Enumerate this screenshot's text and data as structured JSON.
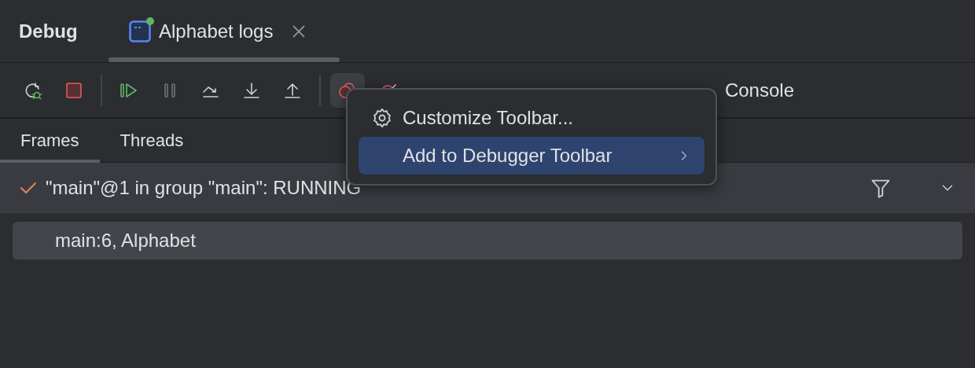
{
  "panel": {
    "title": "Debug"
  },
  "tabs": [
    {
      "label": "Alphabet logs",
      "selected": true,
      "running": true,
      "closable": true
    }
  ],
  "toolbar": {
    "groups": [
      {
        "items": [
          {
            "kind": "rerun",
            "disabled": false,
            "selected": false
          },
          {
            "kind": "stop",
            "disabled": false,
            "selected": false
          }
        ]
      },
      {
        "items": [
          {
            "kind": "resume",
            "disabled": false,
            "selected": false
          },
          {
            "kind": "pause",
            "disabled": true,
            "selected": false
          },
          {
            "kind": "step-over",
            "disabled": false,
            "selected": false
          },
          {
            "kind": "step-into",
            "disabled": false,
            "selected": false
          },
          {
            "kind": "step-out",
            "disabled": false,
            "selected": false
          }
        ]
      },
      {
        "items": [
          {
            "kind": "breakpoints",
            "disabled": false,
            "selected": true
          },
          {
            "kind": "mute",
            "disabled": false,
            "selected": false
          }
        ]
      }
    ],
    "console_label": "Console"
  },
  "subtabs": [
    {
      "label": "Frames",
      "selected": true
    },
    {
      "label": "Threads",
      "selected": false
    }
  ],
  "thread": {
    "label": "\"main\"@1 in group \"main\": RUNNING"
  },
  "frames": [
    {
      "label": "main:6, Alphabet",
      "selected": true
    }
  ],
  "context_menu": {
    "items": [
      {
        "label": "Customize Toolbar...",
        "kind": "settings",
        "selected": false
      },
      {
        "label": "Add to Debugger Toolbar",
        "kind": "submenu",
        "selected": true
      }
    ]
  }
}
